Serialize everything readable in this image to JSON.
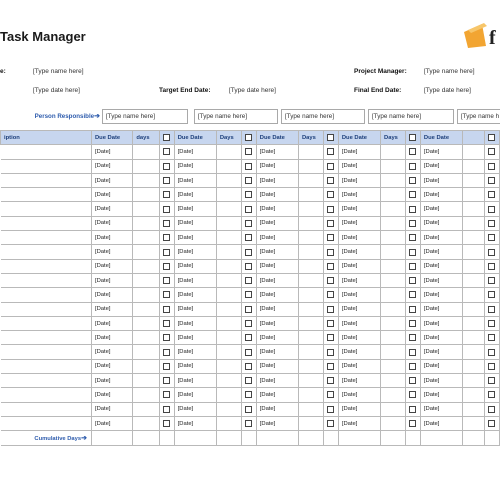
{
  "header": {
    "title": "Task Manager",
    "name_label": "e:",
    "name_value": "[Type name here]",
    "date_value": "[Type date here]",
    "target_end_label": "Target End Date:",
    "target_end_value": "[Type date here]",
    "project_manager_label": "Project Manager:",
    "project_manager_value": "[Type name here]",
    "final_end_label": "Final End Date:",
    "final_end_value": "[Type date here]"
  },
  "person_responsible_label": "Person Responsible",
  "person_slots": [
    "[Type name here]",
    "[Type name here]",
    "[Type name here]",
    "[Type name here]",
    "[Type name h"
  ],
  "columns": {
    "description": "iption",
    "groups": [
      {
        "due": "Due Date",
        "days": "days"
      },
      {
        "due": "Due Date",
        "days": "Days"
      },
      {
        "due": "Due Date",
        "days": "Days"
      },
      {
        "due": "Due Date",
        "days": "Days"
      },
      {
        "due": "Due Date",
        "days": ""
      }
    ]
  },
  "row_placeholder": "[Date]",
  "row_count": 20,
  "cumulative_label": "Cumulative Days",
  "colors": {
    "header_bg": "#c7d6ef",
    "label_blue": "#2e5cad",
    "logo_orange": "#f2a532"
  }
}
